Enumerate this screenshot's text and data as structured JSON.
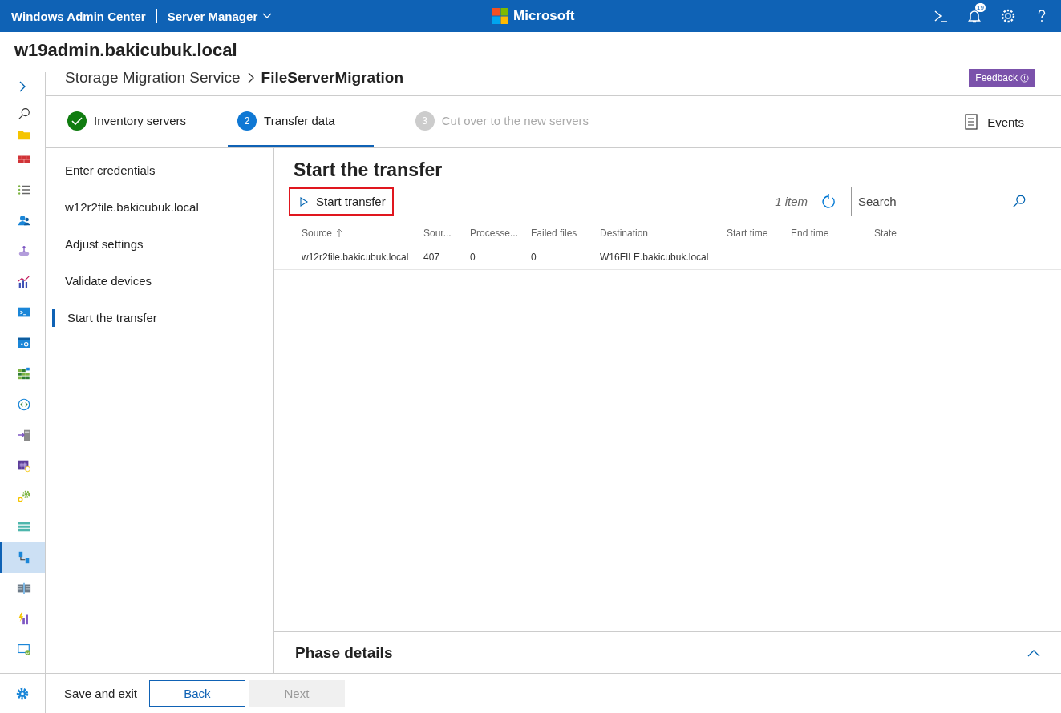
{
  "header": {
    "product": "Windows Admin Center",
    "tool": "Server Manager",
    "brand": "Microsoft",
    "notification_count": "19"
  },
  "rail": {
    "tools": [
      {
        "kind": "search",
        "selected": false
      },
      {
        "kind": "folder",
        "selected": false
      },
      {
        "kind": "firewall",
        "selected": false
      },
      {
        "kind": "list",
        "selected": false
      },
      {
        "kind": "users",
        "selected": false
      },
      {
        "kind": "network",
        "selected": false
      },
      {
        "kind": "chart",
        "selected": false
      },
      {
        "kind": "terminal",
        "selected": false
      },
      {
        "kind": "services",
        "selected": false
      },
      {
        "kind": "grid",
        "selected": false
      },
      {
        "kind": "remote",
        "selected": false
      },
      {
        "kind": "migrate",
        "selected": false
      },
      {
        "kind": "calendar",
        "selected": false
      },
      {
        "kind": "gears",
        "selected": false
      },
      {
        "kind": "storage",
        "selected": false
      },
      {
        "kind": "transfer",
        "selected": true
      },
      {
        "kind": "replica",
        "selected": false
      },
      {
        "kind": "insights",
        "selected": false
      },
      {
        "kind": "update",
        "selected": false
      }
    ]
  },
  "server": "w19admin.bakicubuk.local",
  "breadcrumb": {
    "parent": "Storage Migration Service",
    "current": "FileServerMigration"
  },
  "feedback": "Feedback",
  "steps": [
    {
      "label": "Inventory servers",
      "completed": true,
      "disabled": false,
      "selected": false
    },
    {
      "number": "2",
      "label": "Transfer data",
      "completed": false,
      "disabled": false,
      "selected": true
    },
    {
      "number": "3",
      "label": "Cut over to the new servers",
      "completed": false,
      "disabled": true,
      "selected": false
    }
  ],
  "events": "Events",
  "nav": [
    {
      "label": "Enter credentials",
      "selected": false
    },
    {
      "label": "w12r2file.bakicubuk.local",
      "selected": false
    },
    {
      "label": "Adjust settings",
      "selected": false
    },
    {
      "label": "Validate devices",
      "selected": false
    },
    {
      "label": "Start the transfer",
      "selected": true
    }
  ],
  "title": "Start the transfer",
  "toolbar": {
    "action": "Start transfer",
    "highlighted": true,
    "count": "1 item",
    "search": {
      "placeholder": "Search"
    }
  },
  "table": {
    "columns": [
      {
        "label": "Source",
        "sorted": true
      },
      {
        "label": "Sour...",
        "sorted": false
      },
      {
        "label": "Processe...",
        "sorted": false
      },
      {
        "label": "Failed files",
        "sorted": false
      },
      {
        "label": "Destination",
        "sorted": false
      },
      {
        "label": "Start time",
        "sorted": false
      },
      {
        "label": "End time",
        "sorted": false
      },
      {
        "label": "State",
        "sorted": false
      }
    ],
    "rows": [
      [
        "w12r2file.bakicubuk.local",
        "407",
        "0",
        "0",
        "W16FILE.bakicubuk.local",
        "",
        "",
        ""
      ]
    ]
  },
  "phase_details": {
    "title": "Phase details",
    "expanded": false
  },
  "footer": {
    "save": "Save and exit",
    "back": "Back",
    "next": "Next",
    "next_disabled": true
  }
}
